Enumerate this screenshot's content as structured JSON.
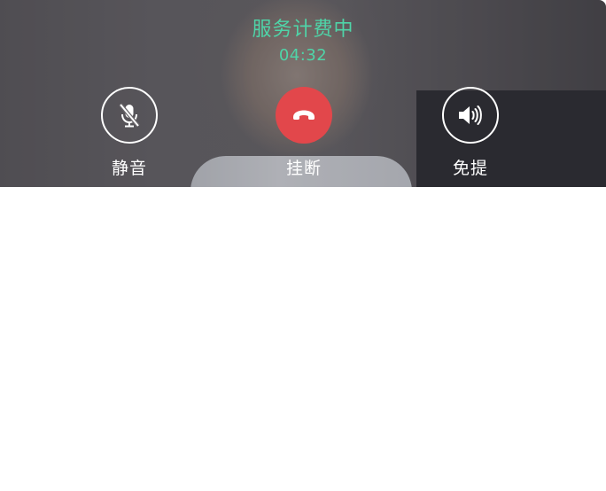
{
  "call": {
    "status": "服务计费中",
    "duration": "04:32"
  },
  "controls": {
    "mute_label": "静音",
    "hangup_label": "挂断",
    "speaker_label": "免提"
  },
  "icons": {
    "mute": "microphone-off-icon",
    "hangup": "phone-hangup-icon",
    "speaker": "speaker-icon"
  },
  "colors": {
    "status_text": "#4fd4a8",
    "hangup_button": "#e2474b"
  }
}
